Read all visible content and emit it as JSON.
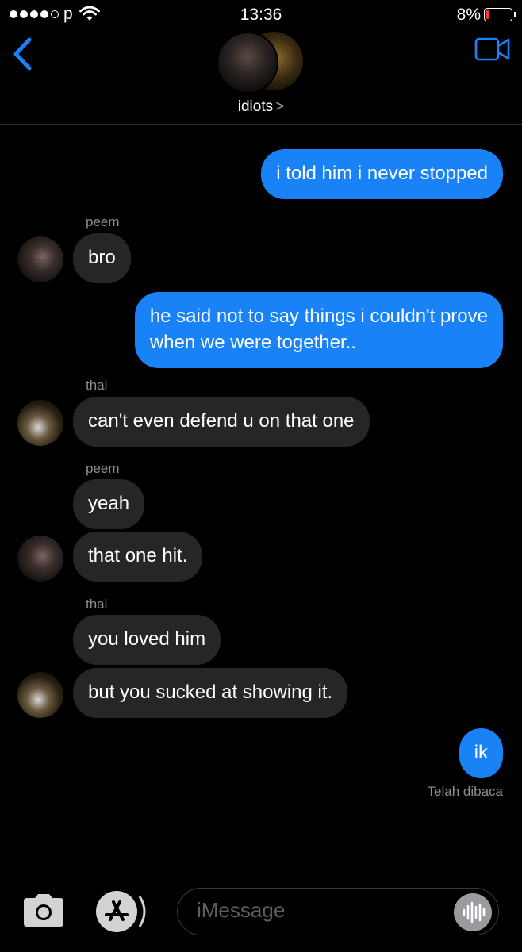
{
  "status_bar": {
    "carrier": "p",
    "time": "13:36",
    "battery": "8%",
    "icons": [
      "signal-dots-icon",
      "wifi-icon",
      "battery-icon"
    ]
  },
  "header": {
    "group_name": "idiots",
    "chevron": ">",
    "icons": [
      "back-chevron-icon",
      "video-call-icon"
    ]
  },
  "messages": [
    {
      "direction": "outgoing",
      "text": "i told him i never stopped"
    },
    {
      "direction": "incoming",
      "sender": "peem",
      "text": "bro"
    },
    {
      "direction": "outgoing",
      "lines": [
        "he said not to say things i couldn't prove",
        "when we were together.."
      ]
    },
    {
      "direction": "incoming",
      "sender": "thai",
      "text": "can't even defend u on that one"
    },
    {
      "direction": "incoming",
      "sender": "peem",
      "text": "yeah"
    },
    {
      "direction": "incoming",
      "sender": "peem",
      "text": "that one hit."
    },
    {
      "direction": "incoming",
      "sender": "thai",
      "text": "you loved him"
    },
    {
      "direction": "incoming",
      "sender": "thai",
      "text": "but you sucked at showing it."
    },
    {
      "direction": "outgoing",
      "text": "ik"
    }
  ],
  "read_receipt": "Telah dibaca",
  "input": {
    "placeholder": "iMessage",
    "icons": [
      "camera-icon",
      "app-store-icon",
      "audio-waveform-icon"
    ]
  },
  "colors": {
    "background": "#000000",
    "outgoing_bubble": "#1a82f7",
    "incoming_bubble": "#262629",
    "accent": "#1a82f7",
    "battery_low": "#ff3b30"
  }
}
